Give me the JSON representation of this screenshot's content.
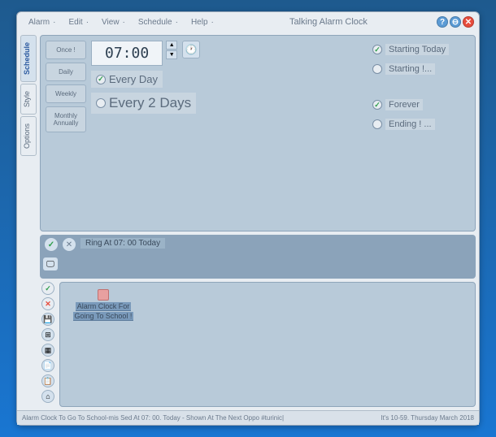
{
  "title": "Talking Alarm Clock",
  "menu": {
    "alarm": "Alarm",
    "edit": "Edit",
    "view": "View",
    "schedule": "Schedule",
    "help": "Help"
  },
  "sideTabs": {
    "schedule": "Schedule",
    "style": "Style",
    "options": "Options"
  },
  "freq": {
    "once": "Once !",
    "daily": "Daily",
    "weekly": "Weekly",
    "monthly": "Monthly Annually"
  },
  "time": "07:00",
  "recurrence": {
    "everyday": "Every Day",
    "every2": "Every 2 Days"
  },
  "range": {
    "startingToday": "Starting Today",
    "starting": "Starting !...",
    "forever": "Forever",
    "ending": "Ending ! ..."
  },
  "summary": "Ring At 07: 00 Today",
  "alarmItem": {
    "line1": "Alarm Clock For",
    "line2": "Going To School !"
  },
  "status": {
    "left": "Alarm Clock To Go To School-mis Sed At 07: 00. Today - Shown At The Next Oppo #turinic|",
    "right": "It's 10-59. Thursday March 2018"
  }
}
